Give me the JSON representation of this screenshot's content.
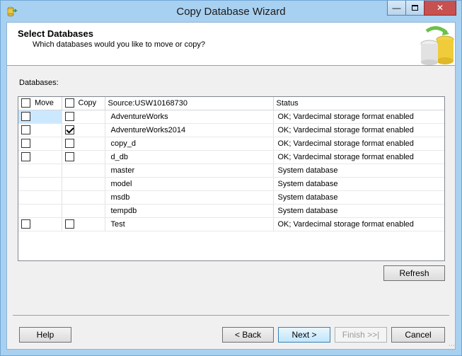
{
  "window": {
    "title": "Copy Database Wizard",
    "icon": "copy-database-icon"
  },
  "header": {
    "title": "Select Databases",
    "subtitle": "Which databases would you like to move or copy?"
  },
  "databases_label": "Databases:",
  "grid": {
    "columns": {
      "move": "Move",
      "copy": "Copy",
      "source": "Source:USW10168730",
      "status": "Status"
    },
    "rows": [
      {
        "has_checkboxes": true,
        "move": false,
        "copy": false,
        "source": "AdventureWorks",
        "status": "OK; Vardecimal storage format enabled",
        "selected": true
      },
      {
        "has_checkboxes": true,
        "move": false,
        "copy": true,
        "source": "AdventureWorks2014",
        "status": "OK; Vardecimal storage format enabled",
        "selected": false
      },
      {
        "has_checkboxes": true,
        "move": false,
        "copy": false,
        "source": "copy_d",
        "status": "OK; Vardecimal storage format enabled",
        "selected": false
      },
      {
        "has_checkboxes": true,
        "move": false,
        "copy": false,
        "source": "d_db",
        "status": "OK; Vardecimal storage format enabled",
        "selected": false
      },
      {
        "has_checkboxes": false,
        "move": false,
        "copy": false,
        "source": "master",
        "status": "System database",
        "selected": false
      },
      {
        "has_checkboxes": false,
        "move": false,
        "copy": false,
        "source": "model",
        "status": "System database",
        "selected": false
      },
      {
        "has_checkboxes": false,
        "move": false,
        "copy": false,
        "source": "msdb",
        "status": "System database",
        "selected": false
      },
      {
        "has_checkboxes": false,
        "move": false,
        "copy": false,
        "source": "tempdb",
        "status": "System database",
        "selected": false
      },
      {
        "has_checkboxes": true,
        "move": false,
        "copy": false,
        "source": "Test",
        "status": "OK; Vardecimal storage format enabled",
        "selected": false
      }
    ]
  },
  "buttons": {
    "refresh": "Refresh",
    "help": "Help",
    "back": "< Back",
    "next": "Next >",
    "finish": "Finish >>|",
    "cancel": "Cancel"
  }
}
